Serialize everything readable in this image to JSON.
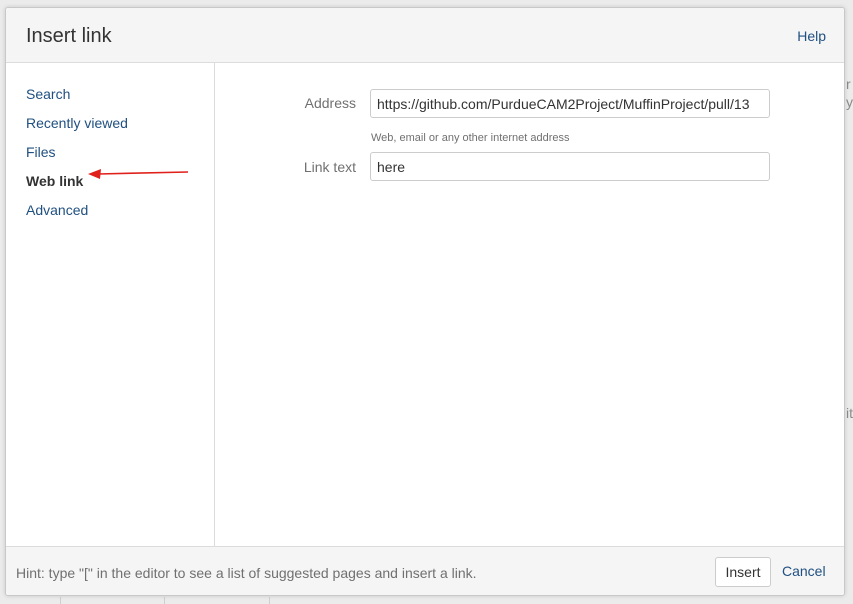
{
  "dialog": {
    "title": "Insert link",
    "help_label": "Help"
  },
  "sidebar": {
    "items": [
      {
        "label": "Search",
        "active": false
      },
      {
        "label": "Recently viewed",
        "active": false
      },
      {
        "label": "Files",
        "active": false
      },
      {
        "label": "Web link",
        "active": true
      },
      {
        "label": "Advanced",
        "active": false
      }
    ]
  },
  "form": {
    "address_label": "Address",
    "address_value": "https://github.com/PurdueCAM2Project/MuffinProject/pull/13",
    "address_hint": "Web, email or any other internet address",
    "link_text_label": "Link text",
    "link_text_value": "here"
  },
  "footer": {
    "hint": "Hint: type \"[\" in the editor to see a list of suggested pages and insert a link.",
    "insert_label": "Insert",
    "cancel_label": "Cancel"
  },
  "colors": {
    "link": "#205081",
    "annotation_arrow": "#e0201b"
  }
}
